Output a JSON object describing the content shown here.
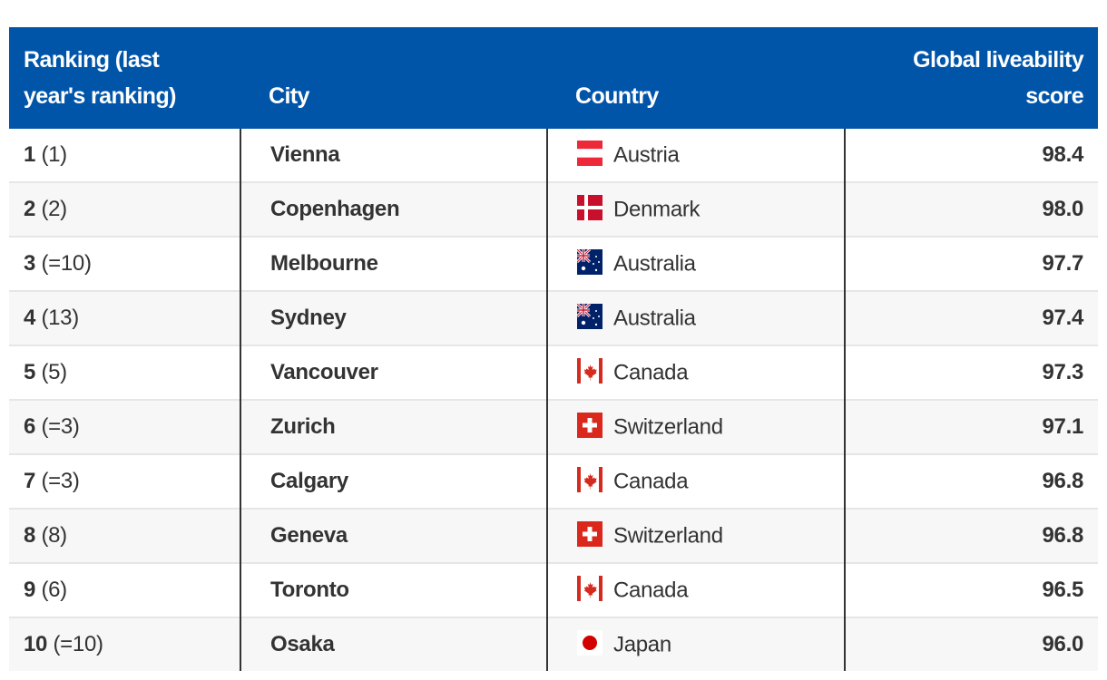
{
  "headers": {
    "ranking": "Ranking (last year's ranking)",
    "city": "City",
    "country": "Country",
    "score": "Global liveability score"
  },
  "rows": [
    {
      "rank": "1",
      "last": "(1)",
      "city": "Vienna",
      "country": "Austria",
      "flag": "austria-flag",
      "score": "98.4"
    },
    {
      "rank": "2",
      "last": "(2)",
      "city": "Copenhagen",
      "country": "Denmark",
      "flag": "denmark-flag",
      "score": "98.0"
    },
    {
      "rank": "3",
      "last": "(=10)",
      "city": "Melbourne",
      "country": "Australia",
      "flag": "australia-flag",
      "score": "97.7"
    },
    {
      "rank": "4",
      "last": "(13)",
      "city": "Sydney",
      "country": "Australia",
      "flag": "australia-flag",
      "score": "97.4"
    },
    {
      "rank": "5",
      "last": "(5)",
      "city": "Vancouver",
      "country": "Canada",
      "flag": "canada-flag",
      "score": "97.3"
    },
    {
      "rank": "6",
      "last": "(=3)",
      "city": "Zurich",
      "country": "Switzerland",
      "flag": "switzerland-flag",
      "score": "97.1"
    },
    {
      "rank": "7",
      "last": "(=3)",
      "city": "Calgary",
      "country": "Canada",
      "flag": "canada-flag",
      "score": "96.8"
    },
    {
      "rank": "8",
      "last": "(8)",
      "city": "Geneva",
      "country": "Switzerland",
      "flag": "switzerland-flag",
      "score": "96.8"
    },
    {
      "rank": "9",
      "last": "(6)",
      "city": "Toronto",
      "country": "Canada",
      "flag": "canada-flag",
      "score": "96.5"
    },
    {
      "rank": "10",
      "last": "(=10)",
      "city": "Osaka",
      "country": "Japan",
      "flag": "japan-flag",
      "score": "96.0"
    }
  ],
  "colors": {
    "header_bg": "#0155a9",
    "header_text": "#ffffff",
    "alt_row": "#f7f7f7"
  }
}
